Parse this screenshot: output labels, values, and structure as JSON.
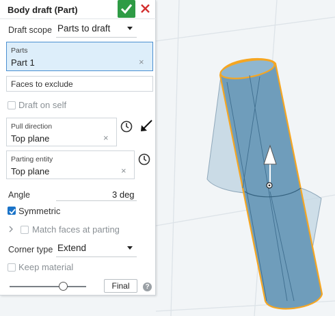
{
  "panel": {
    "title": "Body draft (Part)",
    "draft_scope": {
      "label": "Draft scope",
      "value": "Parts to draft"
    },
    "parts": {
      "label": "Parts",
      "value": "Part 1"
    },
    "faces_to_exclude": {
      "placeholder": "Faces to exclude"
    },
    "draft_on_self": {
      "label": "Draft on self",
      "checked": false
    },
    "pull_direction": {
      "label": "Pull direction",
      "value": "Top plane"
    },
    "parting_entity": {
      "label": "Parting entity",
      "value": "Top plane"
    },
    "angle": {
      "label": "Angle",
      "value": "3 deg"
    },
    "symmetric": {
      "label": "Symmetric",
      "checked": true
    },
    "match_faces": {
      "label": "Match faces at parting",
      "checked": false
    },
    "corner_type": {
      "label": "Corner type",
      "value": "Extend"
    },
    "keep_material": {
      "label": "Keep material",
      "checked": false
    },
    "final_button": "Final",
    "help": "?",
    "clear_glyph": "×"
  },
  "colors": {
    "confirm": "#2e9b45",
    "cancel": "#d32f2f",
    "selection_fill": "#ddeefa",
    "selection_border": "#4a8fd1",
    "checkbox": "#1a73c8",
    "part_highlight": "#f5a623",
    "part_fill": "#6f9dbb"
  }
}
